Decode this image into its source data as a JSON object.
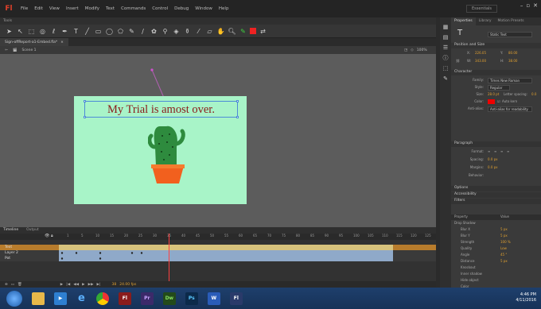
{
  "app": {
    "logo": "Fl",
    "menu": [
      "File",
      "Edit",
      "View",
      "Insert",
      "Modify",
      "Text",
      "Commands",
      "Control",
      "Debug",
      "Window",
      "Help"
    ],
    "workspace": "Essentials",
    "window_buttons": [
      "–",
      "▫",
      "✕"
    ]
  },
  "tools_panel": {
    "title": "Tools"
  },
  "document": {
    "tab_title": "Sign-offReport-a1-Embed.fla*",
    "scene_label": "Scene 1",
    "zoom": "100%"
  },
  "stage": {
    "text": "My Trial is amost over.",
    "background": "#a8f4c8",
    "text_color": "#8b1a1a",
    "pot_color": "#f2601e",
    "cactus_color": "#2e8b3e"
  },
  "timeline": {
    "tabs": [
      "Timeline",
      "Output"
    ],
    "frame_numbers": [
      "1",
      "5",
      "10",
      "15",
      "20",
      "25",
      "30",
      "35",
      "40",
      "45",
      "50",
      "55",
      "60",
      "65",
      "70",
      "75",
      "80",
      "85",
      "90",
      "95",
      "100",
      "105",
      "110",
      "115",
      "120",
      "125"
    ],
    "layers": [
      {
        "name": "Text"
      },
      {
        "name": "Layer 2"
      },
      {
        "name": "Pot"
      }
    ],
    "controls": [
      "▶",
      "|◀",
      "◀◀",
      "▶",
      "▶▶",
      "▶|"
    ],
    "fps": "24.00 fps",
    "current_frame": "38"
  },
  "properties": {
    "tabs": [
      "Properties",
      "Library",
      "Motion Presets"
    ],
    "sections": {
      "position_size": "Position and Size",
      "character": "Character",
      "paragraph": "Paragraph",
      "options": "Options",
      "accessibility": "Accessibility",
      "filters": "Filters"
    },
    "text_type": "Static Text",
    "x_label": "X:",
    "x_value": "226.05",
    "y_label": "Y:",
    "y_value": "80.00",
    "w_label": "W:",
    "w_value": "343.00",
    "h_label": "H:",
    "h_value": "38.00",
    "family_label": "Family:",
    "family_value": "Times New Roman",
    "style_label": "Style:",
    "style_value": "Regular",
    "size_label": "Size:",
    "size_value": "28.0 pt",
    "spacing_label": "Letter spacing:",
    "spacing_value": "0.0",
    "color_label": "Color:",
    "auto_kern": "Auto kern",
    "anti_alias_label": "Anti-alias:",
    "anti_alias_value": "Anti-alias for readability",
    "format_label": "Format:",
    "spacing2_label": "Spacing:",
    "spacing2_value": "0.0 px",
    "margins_label": "Margins:",
    "margins_value": "0.0 px",
    "behavior_label": "Behavior:",
    "filter_col1": "Property",
    "filter_col2": "Value",
    "filters": [
      {
        "name": "Drop Shadow",
        "value": ""
      },
      {
        "name": "Blur X",
        "value": "5 px"
      },
      {
        "name": "Blur Y",
        "value": "5 px"
      },
      {
        "name": "Strength",
        "value": "100 %"
      },
      {
        "name": "Quality",
        "value": "Low"
      },
      {
        "name": "Angle",
        "value": "45 °"
      },
      {
        "name": "Distance",
        "value": "5 px"
      },
      {
        "name": "Knockout",
        "value": ""
      },
      {
        "name": "Inner shadow",
        "value": ""
      },
      {
        "name": "Hide object",
        "value": ""
      },
      {
        "name": "Color",
        "value": ""
      }
    ]
  },
  "taskbar": {
    "apps": [
      "IE",
      "Chrome",
      "Fl",
      "Pr",
      "Dw",
      "Ps",
      "W",
      "Fl"
    ],
    "time": "4:46 PM",
    "date": "4/11/2016"
  }
}
